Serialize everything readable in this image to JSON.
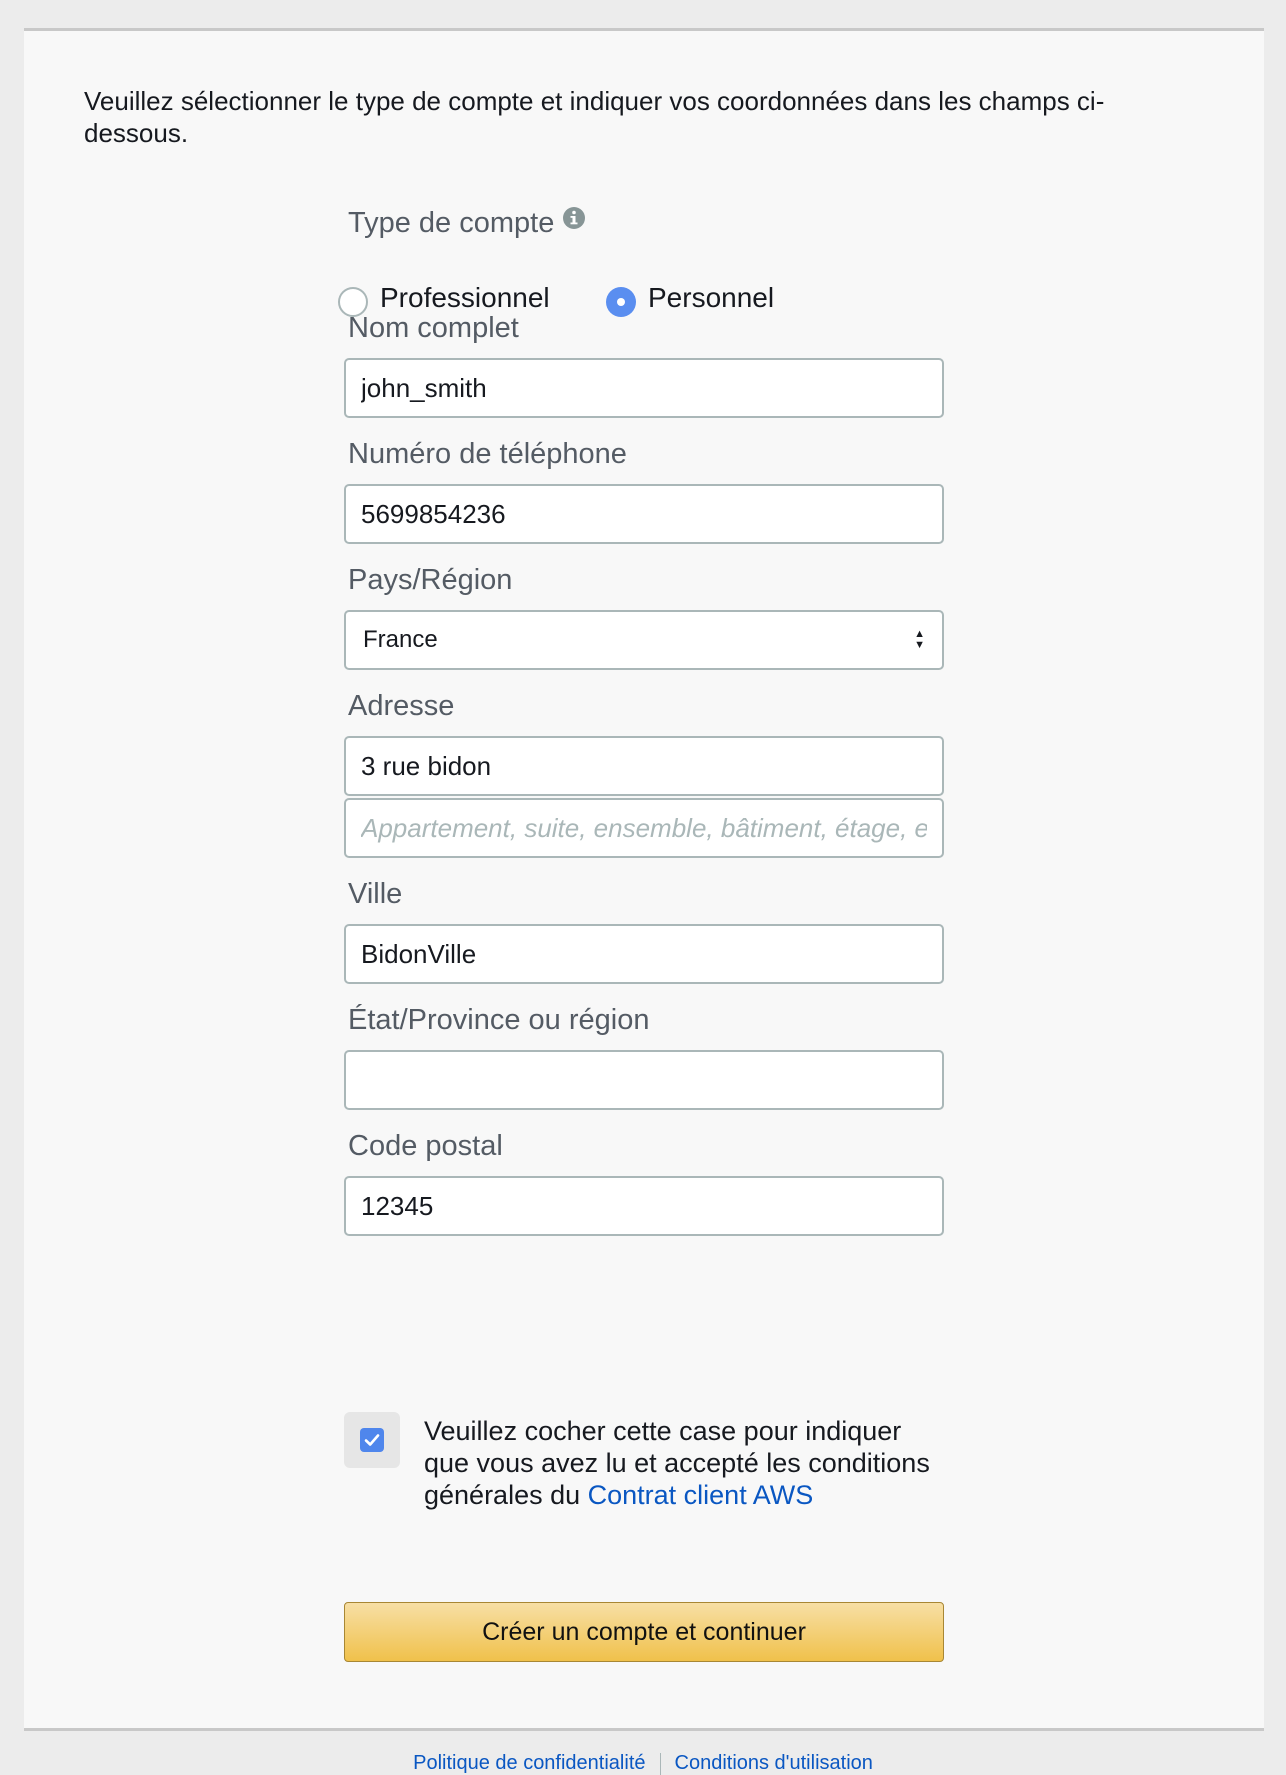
{
  "intro": "Veuillez sélectionner le type de compte et indiquer vos coordonnées dans les champs ci-dessous.",
  "account_type": {
    "label": "Type de compte",
    "options": [
      "Professionnel",
      "Personnel"
    ],
    "selected": "Personnel"
  },
  "full_name": {
    "label": "Nom complet",
    "value": "john_smith"
  },
  "phone": {
    "label": "Numéro de téléphone",
    "value": "5699854236"
  },
  "country": {
    "label": "Pays/Région",
    "value": "France"
  },
  "address": {
    "label": "Adresse",
    "line1": "3 rue bidon",
    "line2_placeholder": "Appartement, suite, ensemble, bâtiment, étage, etc."
  },
  "city": {
    "label": "Ville",
    "value": "BidonVille"
  },
  "state": {
    "label": "État/Province ou région",
    "value": ""
  },
  "postal": {
    "label": "Code postal",
    "value": "12345"
  },
  "agreement": {
    "checked": true,
    "text": "Veuillez cocher cette case pour indiquer que vous avez lu et accepté les conditions générales du ",
    "link": "Contrat client AWS"
  },
  "submit_label": "Créer un compte et continuer",
  "footer": {
    "links": [
      "Politique de confidentialité",
      "Conditions d'utilisation"
    ]
  },
  "colors": {
    "accent_blue": "#5a8ef0",
    "link_blue": "#0a57c2",
    "button_gold": "#f0c14b"
  }
}
